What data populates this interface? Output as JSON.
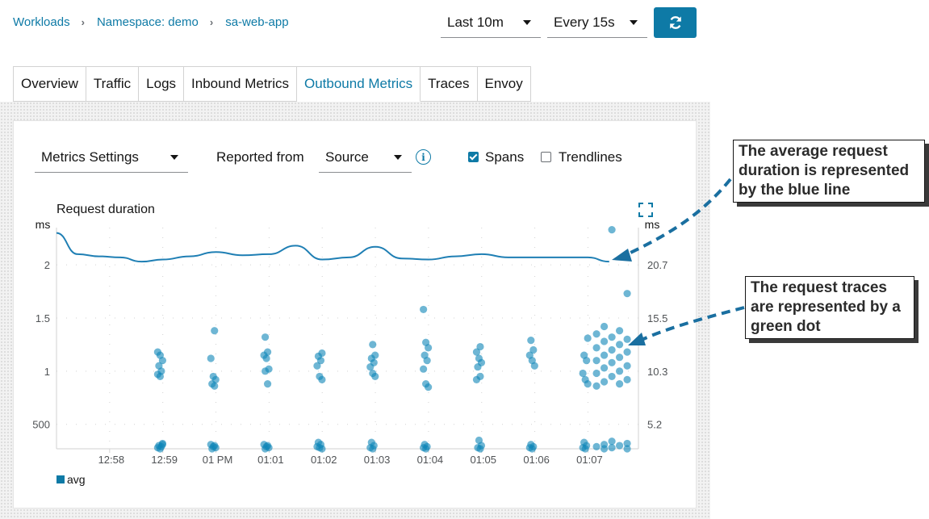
{
  "breadcrumb": {
    "workloads": "Workloads",
    "namespace": "Namespace: demo",
    "app": "sa-web-app"
  },
  "toolbar": {
    "time_range": "Last 10m",
    "refresh_interval": "Every 15s",
    "refresh_icon": "refresh-icon"
  },
  "tabs": [
    {
      "label": "Overview"
    },
    {
      "label": "Traffic"
    },
    {
      "label": "Logs"
    },
    {
      "label": "Inbound Metrics"
    },
    {
      "label": "Outbound Metrics",
      "active": true
    },
    {
      "label": "Traces"
    },
    {
      "label": "Envoy"
    }
  ],
  "controls": {
    "metrics_settings": "Metrics Settings",
    "reported_from_label": "Reported from",
    "reported_from_value": "Source",
    "info_icon": "info-icon",
    "spans_label": "Spans",
    "spans_checked": true,
    "trendlines_label": "Trendlines",
    "trendlines_checked": false
  },
  "colors": {
    "accent": "#0e7aa6",
    "line": "#1f7fb4",
    "dots": "#0e86b8"
  },
  "callouts": {
    "avg": "The average request\nduration is represented\nby the blue line",
    "traces": "The request traces\nare represented by a\ngreen dot"
  },
  "chart_data": {
    "type": "line+scatter",
    "title": "Request duration",
    "y_left_unit": "ms",
    "y_right_unit": "ms",
    "y_left_ticks": [
      "500",
      "1",
      "1.5",
      "2"
    ],
    "y_left_tick_values": [
      0.5,
      1.0,
      1.5,
      2.0
    ],
    "y_right_ticks": [
      "5.2",
      "10.3",
      "15.5",
      "20.7"
    ],
    "x_ticks": [
      "12:58",
      "12:59",
      "01 PM",
      "01:01",
      "01:02",
      "01:03",
      "01:04",
      "01:05",
      "01:06",
      "01:07"
    ],
    "x_tick_minutes": [
      1,
      2,
      3,
      4,
      5,
      6,
      7,
      8,
      9,
      10
    ],
    "y_left_range": [
      0.27,
      2.35
    ],
    "x_range_minutes": [
      0,
      10.95
    ],
    "legend": [
      "avg"
    ],
    "series": [
      {
        "name": "avg",
        "points": [
          [
            0,
            2.3
          ],
          [
            0.4,
            2.1
          ],
          [
            0.8,
            2.08
          ],
          [
            1.2,
            2.07
          ],
          [
            1.6,
            2.03
          ],
          [
            2.0,
            2.05
          ],
          [
            2.5,
            2.08
          ],
          [
            3.0,
            2.12
          ],
          [
            3.5,
            2.09
          ],
          [
            4.0,
            2.1
          ],
          [
            4.5,
            2.18
          ],
          [
            5.0,
            2.05
          ],
          [
            5.5,
            2.07
          ],
          [
            6.0,
            2.17
          ],
          [
            6.5,
            2.06
          ],
          [
            7.0,
            2.05
          ],
          [
            7.5,
            2.08
          ],
          [
            8.0,
            2.1
          ],
          [
            8.5,
            2.07
          ],
          [
            9.0,
            2.07
          ],
          [
            9.5,
            2.07
          ],
          [
            10.0,
            2.07
          ],
          [
            10.4,
            2.03
          ]
        ]
      }
    ],
    "spans": [
      {
        "minute": 1.95,
        "values": [
          1.18,
          1.15,
          1.1,
          1.05,
          1.0,
          0.97,
          0.95,
          0.32,
          0.3,
          0.29,
          0.28,
          0.27,
          0.31
        ]
      },
      {
        "minute": 2.95,
        "values": [
          1.38,
          1.12,
          0.95,
          0.92,
          0.88,
          0.86,
          0.31,
          0.29,
          0.28,
          0.27,
          0.3
        ]
      },
      {
        "minute": 3.95,
        "values": [
          1.32,
          1.18,
          1.15,
          1.12,
          1.02,
          1.0,
          0.88,
          0.31,
          0.29,
          0.28,
          0.27,
          0.3
        ]
      },
      {
        "minute": 4.95,
        "values": [
          1.17,
          1.14,
          1.1,
          1.05,
          0.95,
          0.92,
          0.33,
          0.31,
          0.29,
          0.28,
          0.27
        ]
      },
      {
        "minute": 5.95,
        "values": [
          1.25,
          1.15,
          1.12,
          1.08,
          1.04,
          0.98,
          0.95,
          0.33,
          0.3,
          0.28,
          0.27
        ]
      },
      {
        "minute": 6.95,
        "values": [
          1.58,
          1.27,
          1.22,
          1.15,
          1.1,
          1.02,
          0.88,
          0.85,
          0.31,
          0.29,
          0.28,
          0.27
        ]
      },
      {
        "minute": 7.95,
        "values": [
          1.23,
          1.18,
          1.12,
          1.08,
          1.04,
          0.95,
          0.92,
          0.35,
          0.3,
          0.28,
          0.27
        ]
      },
      {
        "minute": 8.95,
        "values": [
          1.29,
          1.2,
          1.15,
          1.1,
          1.05,
          0.31,
          0.29,
          0.28,
          0.27
        ]
      },
      {
        "minute": 9.95,
        "values": [
          1.31,
          1.15,
          1.1,
          0.98,
          0.92,
          0.88,
          0.33,
          0.3,
          0.28,
          0.27
        ]
      },
      {
        "minute": 10.45,
        "values": [
          2.33,
          1.73,
          1.42,
          1.38,
          1.35,
          1.32,
          1.3,
          1.28,
          1.25,
          1.22,
          1.2,
          1.18,
          1.15,
          1.13,
          1.1,
          1.08,
          1.05,
          1.03,
          1.0,
          0.98,
          0.95,
          0.92,
          0.9,
          0.88,
          0.86,
          0.34,
          0.32,
          0.31,
          0.3,
          0.29,
          0.28,
          0.27,
          0.27
        ]
      }
    ]
  }
}
